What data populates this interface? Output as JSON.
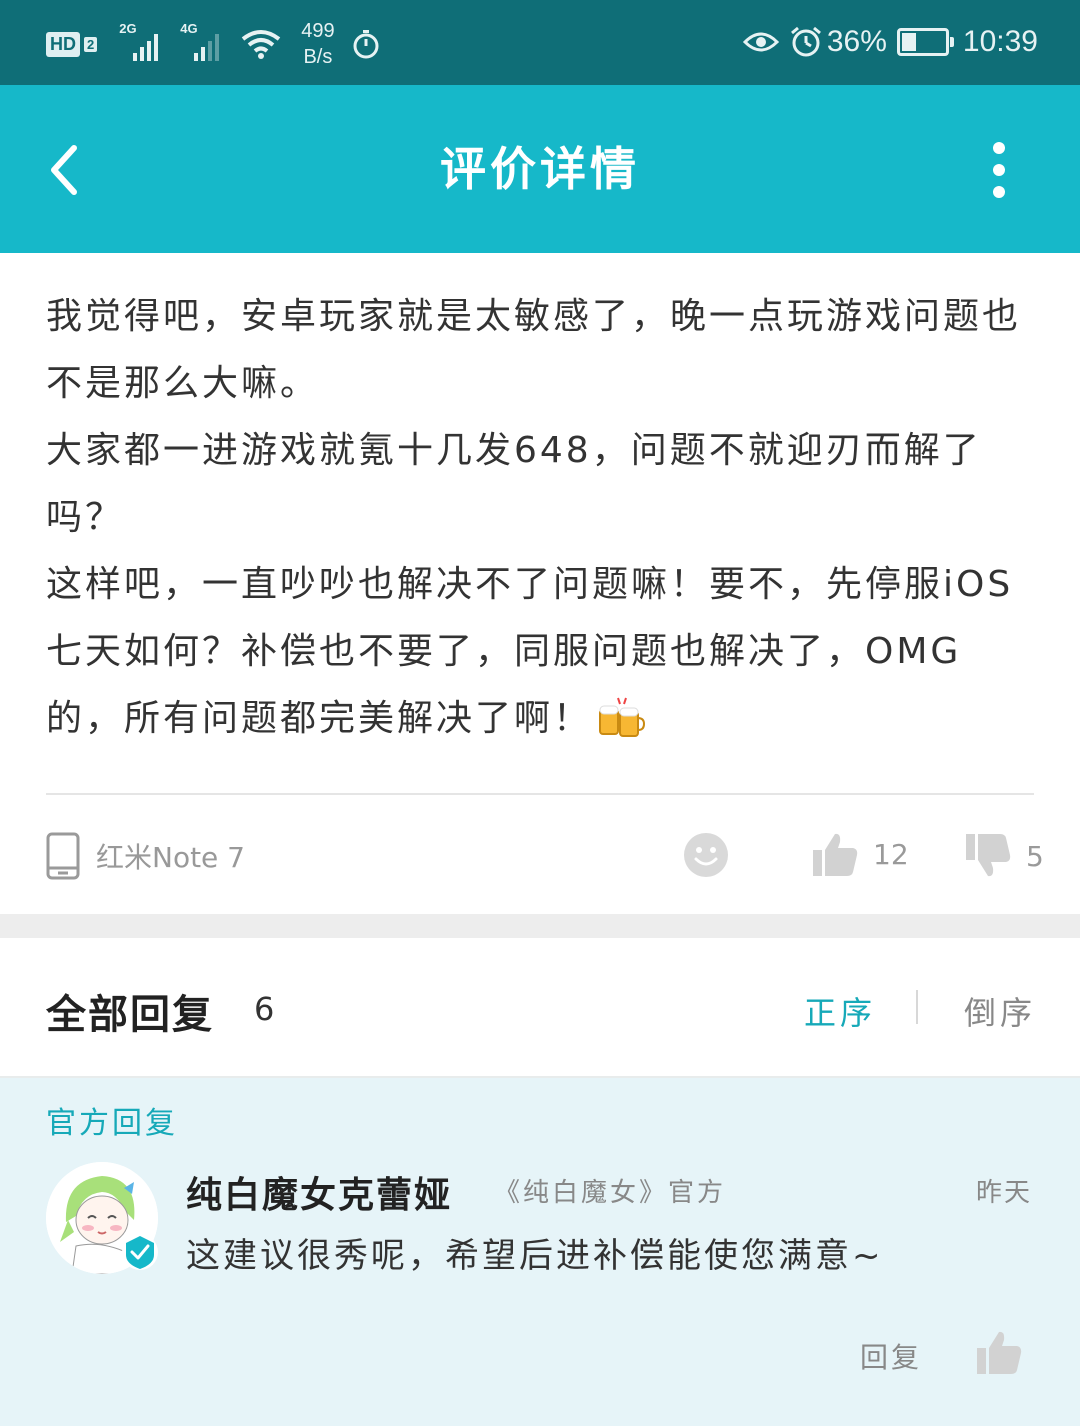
{
  "status_bar": {
    "hd": "HD",
    "hd_sim": "2",
    "sim1_net": "2G",
    "sim2_net": "4G",
    "speed_value": "499",
    "speed_unit": "B/s",
    "battery": "36%",
    "time": "10:39"
  },
  "header": {
    "title": "评价详情",
    "back_icon": "chevron-left-icon",
    "more_icon": "more-vertical-icon"
  },
  "post": {
    "paragraphs": [
      "我觉得吧，安卓玩家就是太敏感了，晚一点玩游戏问题也不是那么大嘛。",
      "大家都一进游戏就氪十几发648，问题不就迎刃而解了吗？",
      "这样吧，一直吵吵也解决不了问题嘛！要不，先停服iOS七天如何？补偿也不要了，同服问题也解决了，OMG的，所有问题都完美解决了啊！"
    ],
    "emoji_icon": "beer-mugs-icon"
  },
  "meta": {
    "device": "红米Note 7",
    "like_count": "12",
    "dislike_count": "5"
  },
  "replies": {
    "title": "全部回复",
    "count": "6",
    "sort_asc": "正序",
    "sort_desc": "倒序"
  },
  "official_reply": {
    "label": "官方回复",
    "name": "纯白魔女克蕾娅",
    "source": "《纯白魔女》官方",
    "time": "昨天",
    "text": "这建议很秀呢，希望后进补偿能使您满意~",
    "reply_label": "回复"
  },
  "colors": {
    "status_bar": "#0f6e77",
    "header": "#16b8c9",
    "accent": "#16a9b8",
    "official_bg": "#e6f4f8"
  }
}
